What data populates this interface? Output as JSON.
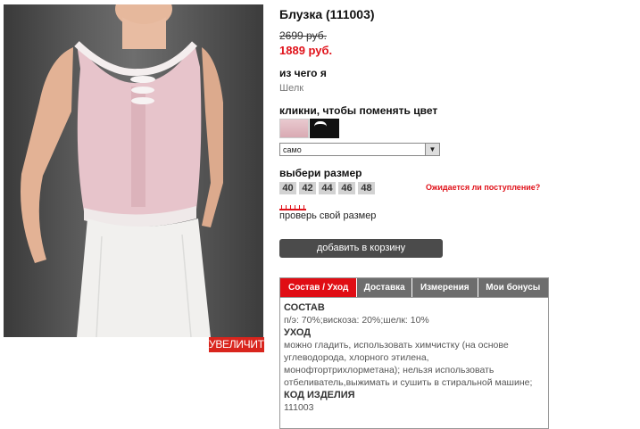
{
  "product": {
    "title": "Блузка (111003)",
    "old_price": "2699 руб.",
    "new_price": "1889 руб.",
    "material_label": "из чего я",
    "material_value": "Шелк",
    "color_label": "кликни, чтобы поменять цвет",
    "colors": [
      "pink",
      "black"
    ],
    "color_select_value": "само",
    "size_label": "выбери размер",
    "sizes": [
      "40",
      "42",
      "44",
      "46",
      "48"
    ],
    "notify_text": "Ожидается ли поступление?",
    "check_size_text": "проверь свой размер",
    "add_to_cart": "добавить в корзину",
    "zoom_text": "УВЕЛИЧИТЬ"
  },
  "tabs": [
    {
      "label": "Состав / Уход",
      "active": true
    },
    {
      "label": "Доставка",
      "active": false
    },
    {
      "label": "Измерения",
      "active": false
    },
    {
      "label": "Мои бонусы",
      "active": false
    }
  ],
  "details": {
    "composition_head": "СОСТАВ",
    "composition": "п/э: 70%;вискоза: 20%;шелк: 10%",
    "care_head": "УХОД",
    "care": "можно гладить, использовать химчистку (на основе углеводорода, хлорного этилена, монофтортрихлорметана); нельзя использовать отбеливатель,выжимать и сушить в стиральной машине;",
    "code_head": "КОД ИЗДЕЛИЯ",
    "code": "111003"
  },
  "colors_hex": {
    "accent": "#e00d14",
    "button": "#4b4b4b",
    "tab": "#6d6d6d"
  }
}
